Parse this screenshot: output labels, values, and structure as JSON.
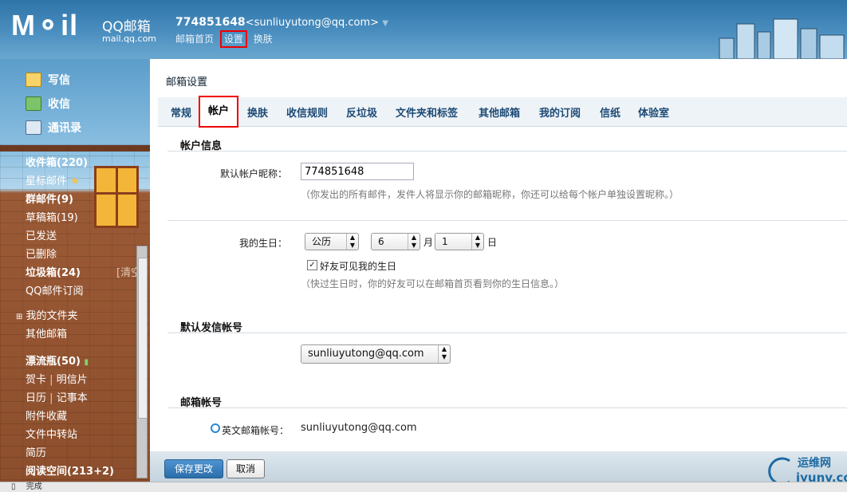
{
  "banner": {
    "logo_big": "M⚬il",
    "logo_name": "QQ邮箱",
    "logo_domain": "mail.qq.com",
    "account_id": "774851648",
    "account_email": "<sunliuyutong@qq.com>",
    "nav": {
      "home": "邮箱首页",
      "settings": "设置",
      "skin": "换肤"
    }
  },
  "sidebar": {
    "compose": "写信",
    "inbox_action": "收信",
    "contacts": "通讯录",
    "folders": {
      "inbox": "收件箱(220)",
      "starred": "星标邮件",
      "group": "群邮件(9)",
      "drafts": "草稿箱(19)",
      "sent": "已发送",
      "deleted": "已删除",
      "junk": "垃圾箱(24)",
      "junk_clear": "[清空]",
      "subscriptions": "QQ邮件订阅",
      "my_folders": "我的文件夹",
      "other_mail": "其他邮箱",
      "drift_bottle": "漂流瓶(50)",
      "greeting": "贺卡",
      "postcard": "明信片",
      "calendar": "日历",
      "notes": "记事本",
      "attachments": "附件收藏",
      "file_transfer": "文件中转站",
      "resume": "简历",
      "reading": "阅读空间(213+2)"
    }
  },
  "panel": {
    "title": "邮箱设置",
    "tabs": [
      "常规",
      "帐户",
      "换肤",
      "收信规则",
      "反垃圾",
      "文件夹和标签",
      "其他邮箱",
      "我的订阅",
      "信纸",
      "体验室"
    ],
    "account_info": {
      "heading": "帐户信息",
      "nickname_label": "默认帐户昵称：",
      "nickname_value": "774851648",
      "nickname_hint": "（你发出的所有邮件，发件人将显示你的邮箱昵称，你还可以给每个帐户单独设置昵称。）",
      "birthday_label": "我的生日：",
      "calendar_type": "公历",
      "month": "6",
      "month_unit": "月",
      "day": "1",
      "day_unit": "日",
      "friends_visible": "好友可见我的生日",
      "birthday_hint": "（快过生日时，你的好友可以在邮箱首页看到你的生日信息。）"
    },
    "default_sender": {
      "heading": "默认发信帐号",
      "value": "sunliuyutong@qq.com"
    },
    "mailbox_account": {
      "heading": "邮箱帐号",
      "english_label": "英文邮箱帐号：",
      "english_value": "sunliuyutong@qq.com"
    },
    "buttons": {
      "save": "保存更改",
      "cancel": "取消"
    }
  },
  "statusbar": {
    "text": "完成"
  },
  "watermark": {
    "cn": "运维网",
    "url": "iyunv.com"
  }
}
